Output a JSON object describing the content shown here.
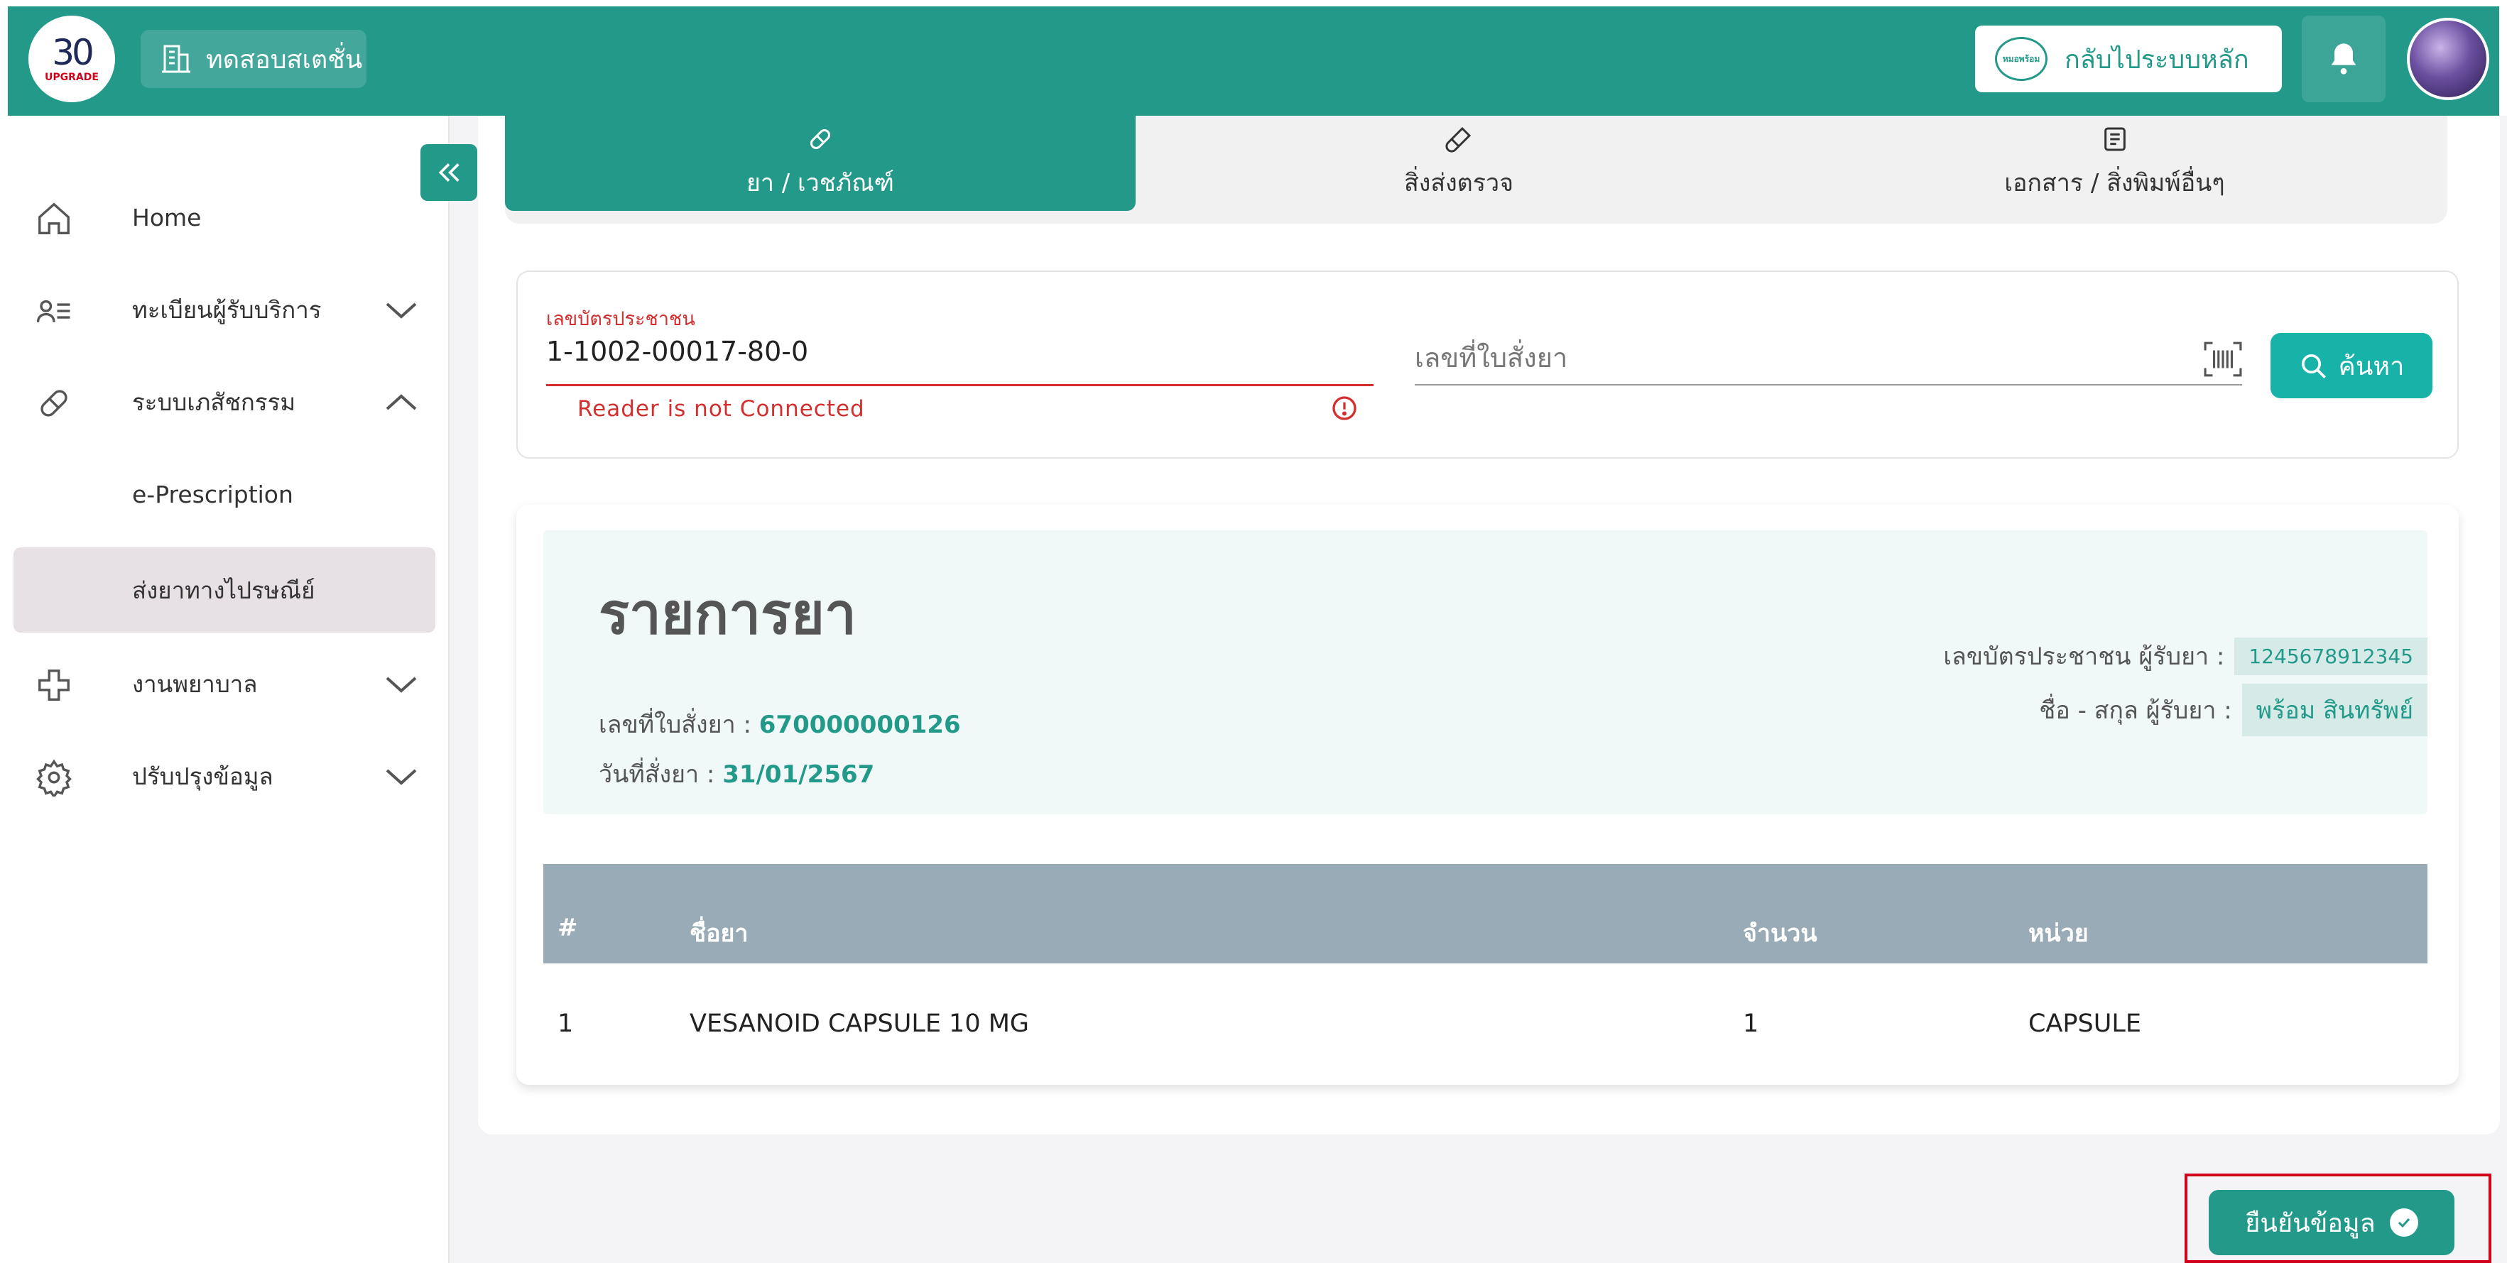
{
  "header": {
    "logo_number": "30",
    "logo_caption": "UPGRADE",
    "station_label": "ทดสอบสเตชั่น",
    "back_label": "กลับไประบบหลัก",
    "back_logo_text": "หมอพร้อม"
  },
  "sidebar": {
    "items": [
      {
        "label": "Home",
        "icon": "home-icon"
      },
      {
        "label": "ทะเบียนผู้รับบริการ",
        "icon": "person-list-icon"
      },
      {
        "label": "ระบบเภสัชกรรม",
        "icon": "pill-icon"
      },
      {
        "label": "e-Prescription"
      },
      {
        "label": "ส่งยาทางไปรษณีย์"
      },
      {
        "label": "งานพยาบาล",
        "icon": "medical-cross-icon"
      },
      {
        "label": "ปรับปรุงข้อมูล",
        "icon": "gear-icon"
      }
    ]
  },
  "tabs": [
    {
      "label": "ยา / เวชภัณฑ์",
      "icon": "pill-icon"
    },
    {
      "label": "สิ่งส่งตรวจ",
      "icon": "test-tube-icon"
    },
    {
      "label": "เอกสาร / สิ่งพิมพ์อื่นๆ",
      "icon": "document-icon"
    }
  ],
  "search": {
    "id_label": "เลขบัตรประชาชน",
    "id_value": "1-1002-00017-80-0",
    "id_error": "Reader is not Connected",
    "rx_placeholder": "เลขที่ใบสั่งยา",
    "button_label": "ค้นหา"
  },
  "drug_list": {
    "title": "รายการยา",
    "rx_no_label": "เลขที่ใบสั่งยา :",
    "rx_no_value": "670000000126",
    "rx_date_label": "วันที่สั่งยา :",
    "rx_date_value": "31/01/2567",
    "recipient_id_label": "เลขบัตรประชาชน ผู้รับยา :",
    "recipient_id_value": "1245678912345",
    "recipient_name_label": "ชื่อ - สกุล ผู้รับยา :",
    "recipient_name_value": "พร้อม สินทรัพย์",
    "columns": [
      "#",
      "ชื่อยา",
      "จำนวน",
      "หน่วย"
    ],
    "rows": [
      [
        "1",
        "VESANOID CAPSULE 10 MG",
        "1",
        "CAPSULE"
      ]
    ]
  },
  "confirm_label": "ยืนยันข้อมูล",
  "colors": {
    "primary": "#23998a",
    "accent": "#17b3a9",
    "error": "#d32f2f",
    "table_header": "#99abb6"
  }
}
